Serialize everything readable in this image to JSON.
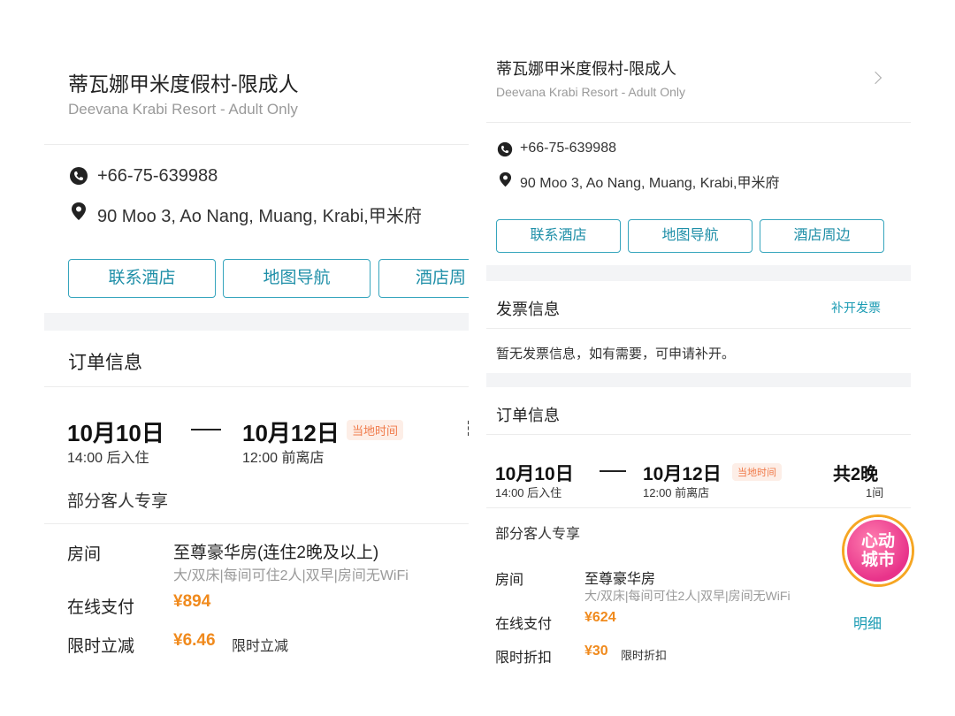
{
  "left": {
    "hotel_name": "蒂瓦娜甲米度假村-限成人",
    "hotel_name_en": "Deevana Krabi Resort - Adult Only",
    "phone": "+66-75-639988",
    "address": "90 Moo 3, Ao Nang, Muang, Krabi,甲米府",
    "buttons": [
      "联系酒店",
      "地图导航",
      "酒店周"
    ],
    "order_title": "订单信息",
    "checkin_date": "10月10日",
    "checkin_time": "14:00 后入住",
    "dash": "—",
    "checkout_date": "10月12日",
    "checkout_time": "12:00 前离店",
    "local_time_tag": "当地时间",
    "more": "⋮",
    "guest_exclusive": "部分客人专享",
    "room_label": "房间",
    "room_name": "至尊豪华房(连住2晚及以上)",
    "room_desc": "大/双床|每间可住2人|双早|房间无WiFi",
    "pay_label": "在线支付",
    "pay_amount": "¥894",
    "discount_label": "限时立减",
    "discount_amount": "¥6.46",
    "discount_note": "限时立减"
  },
  "right": {
    "hotel_name": "蒂瓦娜甲米度假村-限成人",
    "hotel_name_en": "Deevana Krabi Resort - Adult Only",
    "phone": "+66-75-639988",
    "address": "90 Moo 3, Ao Nang, Muang, Krabi,甲米府",
    "buttons": [
      "联系酒店",
      "地图导航",
      "酒店周边"
    ],
    "invoice_title": "发票信息",
    "invoice_action": "补开发票",
    "invoice_text": "暂无发票信息，如有需要，可申请补开。",
    "order_title": "订单信息",
    "checkin_date": "10月10日",
    "checkin_time": "14:00 后入住",
    "dash": "—",
    "checkout_date": "10月12日",
    "checkout_time": "12:00 前离店",
    "local_time_tag": "当地时间",
    "nights": "共2晚",
    "rooms": "1间",
    "guest_exclusive": "部分客人专享",
    "room_label": "房间",
    "room_name": "至尊豪华房",
    "room_desc": "大/双床|每间可住2人|双早|房间无WiFi",
    "pay_label": "在线支付",
    "pay_amount": "¥624",
    "detail_link": "明细",
    "discount_label": "限时折扣",
    "discount_amount": "¥30",
    "discount_note": "限时折扣"
  },
  "badge": {
    "line1": "心动",
    "line2": "城市"
  },
  "colors": {
    "accent": "#1a9bb3",
    "price": "#f08a1d",
    "tag_bg": "#fdeee7"
  },
  "icons": {
    "phone": "phone-icon",
    "location": "location-pin-icon",
    "chevron": "chevron-right-icon"
  }
}
